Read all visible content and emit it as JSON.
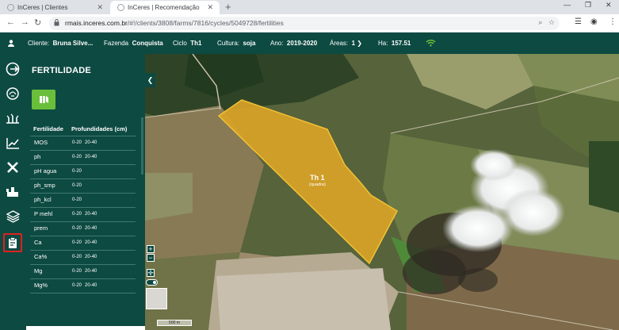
{
  "browser": {
    "tabs": [
      {
        "label": "InCeres | Clientes"
      },
      {
        "label": "InCeres | Recomendação"
      }
    ],
    "new_tab": "+",
    "url_host": "rmais.inceres.com.br",
    "url_path": "/#!/clients/3808/farms/7816/cycles/5049728/fertilities"
  },
  "header": {
    "cliente_label": "Cliente:",
    "cliente_value": "Bruna Silve...",
    "fazenda_label": "Fazenda",
    "fazenda_value": "Conquista",
    "ciclo_label": "Ciclo",
    "ciclo_value": "Th1",
    "cultura_label": "Cultura:",
    "cultura_value": "soja",
    "ano_label": "Ano:",
    "ano_value": "2019-2020",
    "areas_label": "Áreas:",
    "areas_value": "1",
    "ha_label": "Ha:",
    "ha_value": "157.51"
  },
  "panel": {
    "title": "FERTILIDADE",
    "col_fertilidade": "Fertilidade",
    "col_profundidades": "Profundidades (cm)",
    "rows": [
      {
        "name": "MOS",
        "depths": [
          "0-20",
          "20-40"
        ]
      },
      {
        "name": "ph",
        "depths": [
          "0-20",
          "20-40"
        ]
      },
      {
        "name": "pH agua",
        "depths": [
          "0-20"
        ]
      },
      {
        "name": "ph_smp",
        "depths": [
          "0-20"
        ]
      },
      {
        "name": "ph_kcl",
        "depths": [
          "0-20"
        ]
      },
      {
        "name": "P mehl",
        "depths": [
          "0-20",
          "20-40"
        ]
      },
      {
        "name": "prem",
        "depths": [
          "0-20",
          "20-40"
        ]
      },
      {
        "name": "Ca",
        "depths": [
          "0-20",
          "20-40"
        ]
      },
      {
        "name": "Ca%",
        "depths": [
          "0-20",
          "20-40"
        ]
      },
      {
        "name": "Mg",
        "depths": [
          "0-20",
          "20-40"
        ]
      },
      {
        "name": "Mg%",
        "depths": [
          "0-20",
          "20-40"
        ]
      }
    ]
  },
  "map": {
    "field_name": "Th 1",
    "field_sub": "(quadra)",
    "scale_label": "500 m",
    "zoom_in": "+",
    "zoom_out": "−",
    "field_color": "#d9a327"
  }
}
